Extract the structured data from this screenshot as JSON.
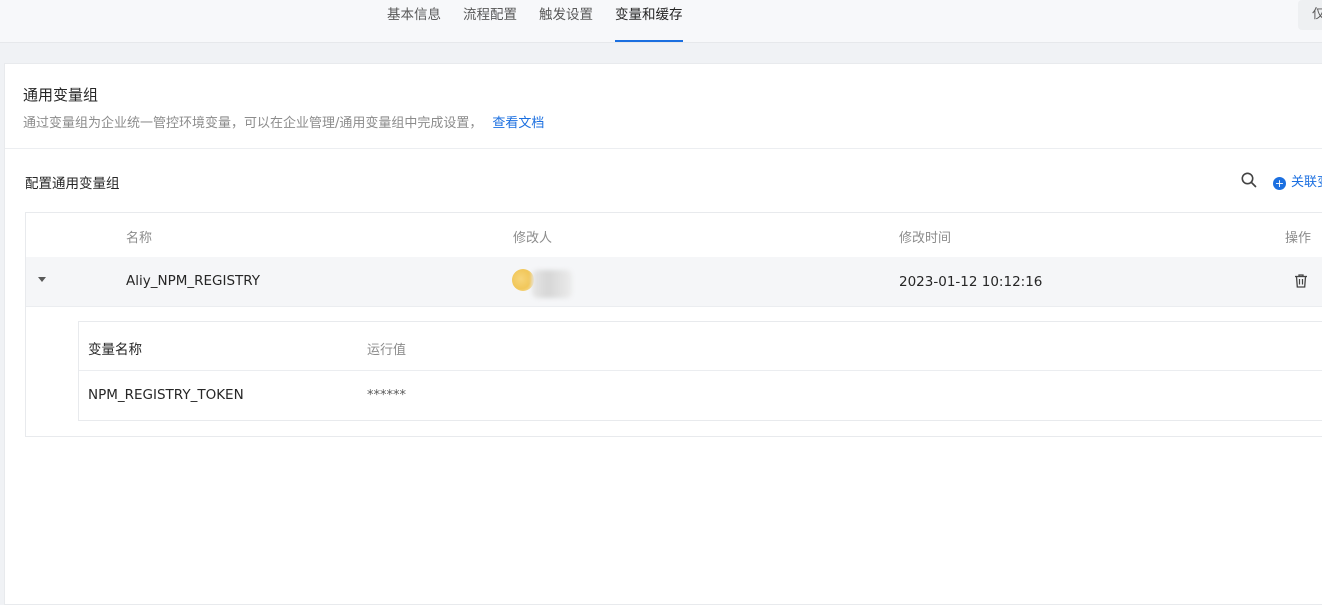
{
  "tabs": [
    {
      "label": "基本信息"
    },
    {
      "label": "流程配置"
    },
    {
      "label": "触发设置"
    },
    {
      "label": "变量和缓存"
    }
  ],
  "top_right_button": "仅",
  "section": {
    "title": "通用变量组",
    "description": "通过变量组为企业统一管控环境变量，可以在企业管理/通用变量组中完成设置，",
    "doc_link": "查看文档"
  },
  "config": {
    "title": "配置通用变量组",
    "link_button": "关联变量组"
  },
  "table": {
    "columns": [
      "名称",
      "修改人",
      "修改时间",
      "操作"
    ],
    "rows": [
      {
        "name": "Aliy_NPM_REGISTRY",
        "modified_at": "2023-01-12 10:12:16"
      }
    ],
    "sub_table": {
      "columns": [
        "变量名称",
        "运行值"
      ],
      "rows": [
        {
          "var_name": "NPM_REGISTRY_TOKEN",
          "value": "******"
        }
      ]
    }
  },
  "colors": {
    "accent": "#1b6fe0",
    "row_bg": "#f5f6f8"
  }
}
